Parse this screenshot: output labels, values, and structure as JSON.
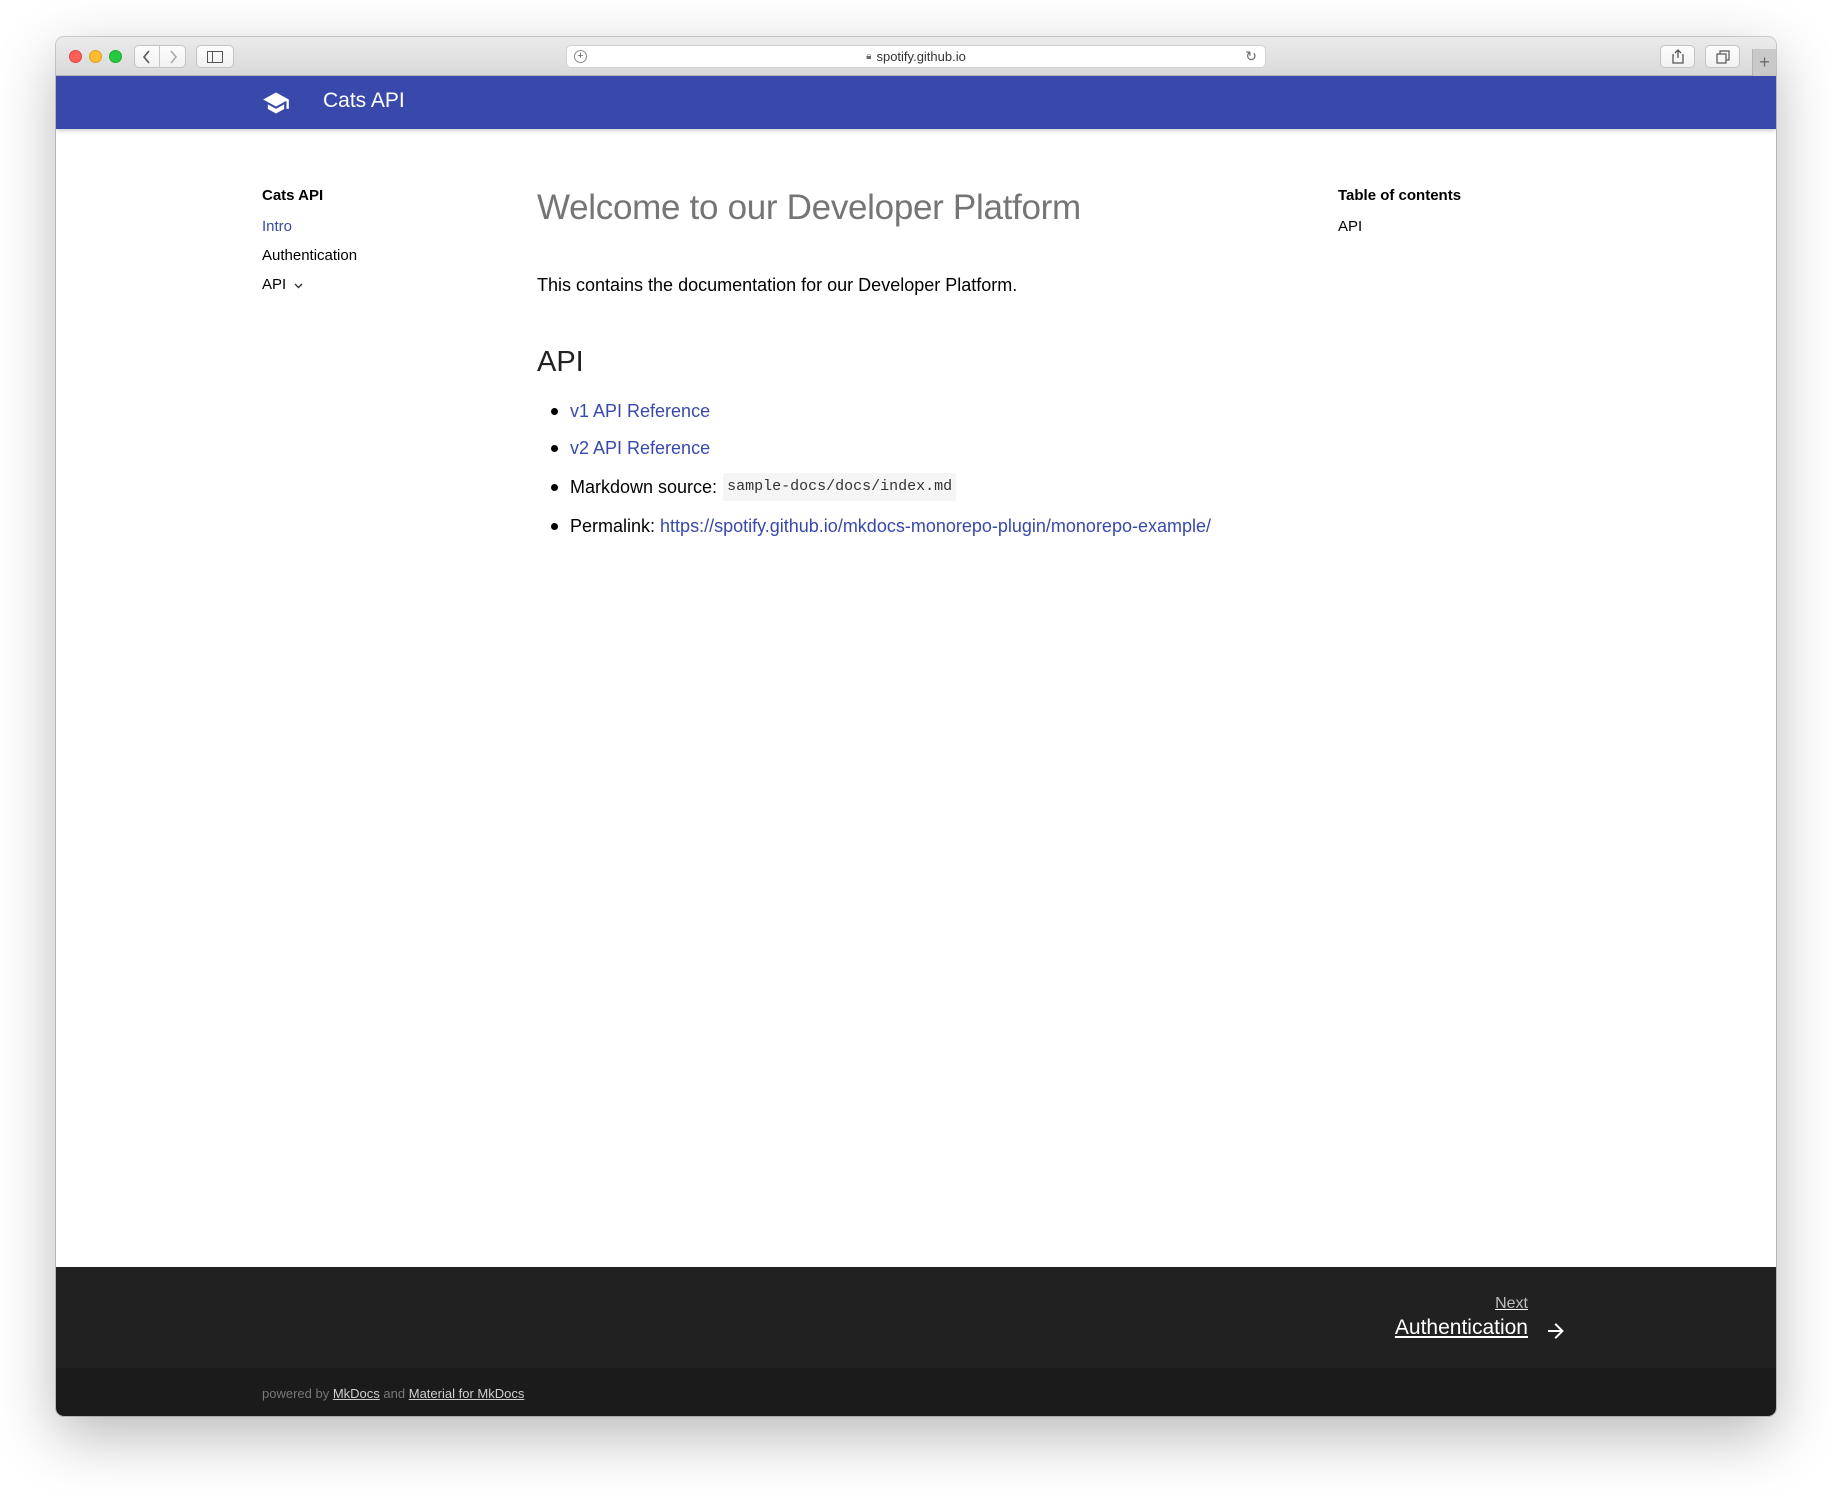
{
  "browser": {
    "url": "spotify.github.io"
  },
  "header": {
    "title": "Cats API"
  },
  "nav": {
    "title": "Cats API",
    "items": [
      {
        "label": "Intro"
      },
      {
        "label": "Authentication"
      },
      {
        "label": "API"
      }
    ]
  },
  "content": {
    "title": "Welcome to our Developer Platform",
    "intro": "This contains the documentation for our Developer Platform.",
    "section_title": "API",
    "items": {
      "v1": "v1 API Reference",
      "v2": "v2 API Reference",
      "markdown_label": "Markdown source:",
      "markdown_path": "sample-docs/docs/index.md",
      "permalink_label": "Permalink:",
      "permalink_url": "https://spotify.github.io/mkdocs-monorepo-plugin/monorepo-example/"
    }
  },
  "toc": {
    "title": "Table of contents",
    "items": [
      {
        "label": "API"
      }
    ]
  },
  "footer": {
    "next_label": "Next",
    "next_title": "Authentication",
    "powered_by": "powered by",
    "mkdocs": "MkDocs",
    "and": "and",
    "material": "Material for MkDocs"
  },
  "colors": {
    "primary": "#3949ab",
    "footer_bg": "#212121",
    "footer_meta_bg": "#1b1b1b"
  }
}
